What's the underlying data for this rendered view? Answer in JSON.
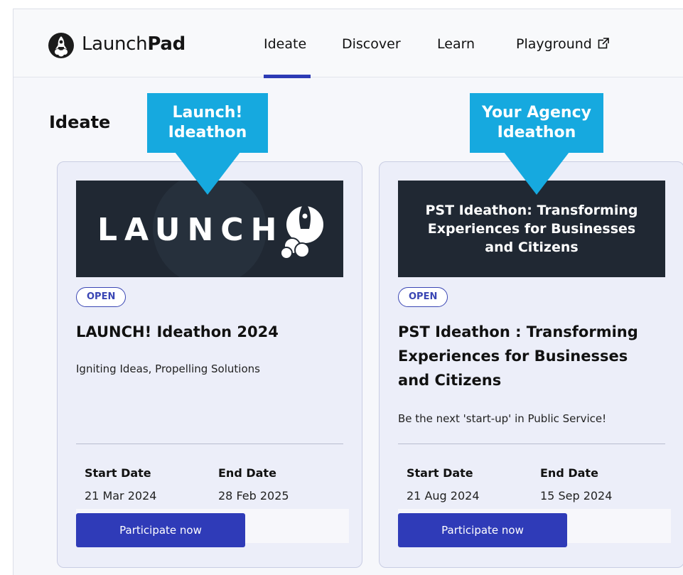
{
  "header": {
    "brand_light": "Launch",
    "brand_bold": "Pad",
    "nav": [
      "Ideate",
      "Discover",
      "Learn",
      "Playground"
    ]
  },
  "page": {
    "title": "Ideate"
  },
  "callouts": [
    {
      "line1": "Launch!",
      "line2": "Ideathon"
    },
    {
      "line1": "Your Agency",
      "line2": "Ideathon"
    }
  ],
  "cards": [
    {
      "banner_text": "LAUNCH",
      "status": "OPEN",
      "title": "LAUNCH! Ideathon 2024",
      "description": "Igniting Ideas, Propelling Solutions",
      "start_label": "Start Date",
      "start_date": "21 Mar 2024",
      "end_label": "End Date",
      "end_date": "28 Feb 2025",
      "button": "Participate now"
    },
    {
      "banner_text": "PST Ideathon: Transforming Experiences for Businesses and Citizens",
      "status": "OPEN",
      "title": "PST Ideathon : Transforming Experiences for Businesses and Citizens",
      "description": "Be the next 'start-up' in Public Service!",
      "start_label": "Start Date",
      "start_date": "21 Aug 2024",
      "end_label": "End Date",
      "end_date": "15 Sep 2024",
      "button": "Participate now"
    }
  ],
  "colors": {
    "accent": "#2f3bb8",
    "callout": "#16a9df",
    "banner_bg": "#202833"
  },
  "icons": [
    "launchpad-logo-icon",
    "external-link-icon",
    "rocket-icon"
  ]
}
